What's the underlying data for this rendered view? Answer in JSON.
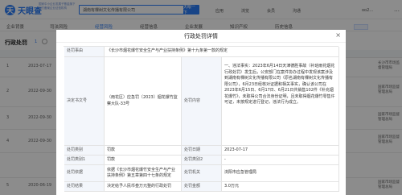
{
  "header": {
    "logo_mark": "天",
    "logo_text": "天眼查",
    "logo_tagline": "国家中小企业发展子基金旗下 官方备案企业征信机构",
    "search_value": "湖南有棵树文化传播有限公司",
    "search_button": "天眼一下",
    "nav": [
      "应用",
      "浏览",
      "会员",
      "沟通",
      "oo2…"
    ],
    "more": "…"
  },
  "tabs": [
    "企业背景",
    "司法风险",
    "经营风险",
    "经营信息",
    "企业发展",
    "知识产权",
    "历史信息"
  ],
  "section": {
    "title": "行政处罚",
    "count": "1"
  },
  "background_rows": [
    {
      "num": "1",
      "date": "2023-07-17",
      "agency": "",
      "org": "长沙市市场监督管理局"
    },
    {
      "num": "2",
      "date": "2022-09-30",
      "agency": "",
      "org": "国家市场监督管理总局"
    },
    {
      "num": "3",
      "date": "2022-09-30",
      "agency": "",
      "org": "国家市场监督管理总局"
    },
    {
      "num": "4",
      "date": "2022-09-30",
      "agency": "",
      "org": "国家市场监督管理总局"
    },
    {
      "num": "5",
      "date": "2020-06-19",
      "agency": "",
      "org": "国家市场监督管理总局"
    }
  ],
  "modal": {
    "title": "行政处罚详情",
    "close": "×",
    "fields": {
      "basis_label": "处罚事由",
      "basis_value": "《长沙市烟花爆竹安全生产与产业扶持条例》第十九条第一款的规定",
      "doc_label": "决定书文号",
      "doc_value": "（雨花区）应急罚〔2023〕烟花爆竹监察大队-33号",
      "content_label": "处罚内容",
      "content_value": "一、违法事实：2023年6月14日天津德胜事故（补班雨花烟花行政处罚）发生后，公安部门在案件协办过程中发现该案涉及到湖南有棵树文化传播有限公司（原名湖南有棵树文化传播有限公司），6月23日经核对证据和相关事实，确认该公司在2023年6月15日、6月17日、6月21日共销售102件《补充烟花爆竹》，未取得公司合法身份证明，且未取得烟花爆竹零售许可证，未按规定进行登记，违法行为成立。",
      "type_label": "处罚类别",
      "type_value": "罚款",
      "date_label": "处罚日期",
      "date_value": "2023-07-17",
      "type1_label": "处罚类别1",
      "type1_value": "罚款",
      "type2_label": "处罚类别2",
      "type2_value": "-",
      "law_label": "处罚依据",
      "law_value": "依据《长沙市烟花爆竹安全生产与产业扶持条例》第五章第四十七条的规定",
      "agency_label": "处罚机关",
      "agency_value": "浏阳市应急管理局",
      "result_label": "处罚结果",
      "result_value": "决定给予人民币叁万元整的行政处罚",
      "amount_label": "处罚金额",
      "amount_value": "3.0万元"
    }
  }
}
